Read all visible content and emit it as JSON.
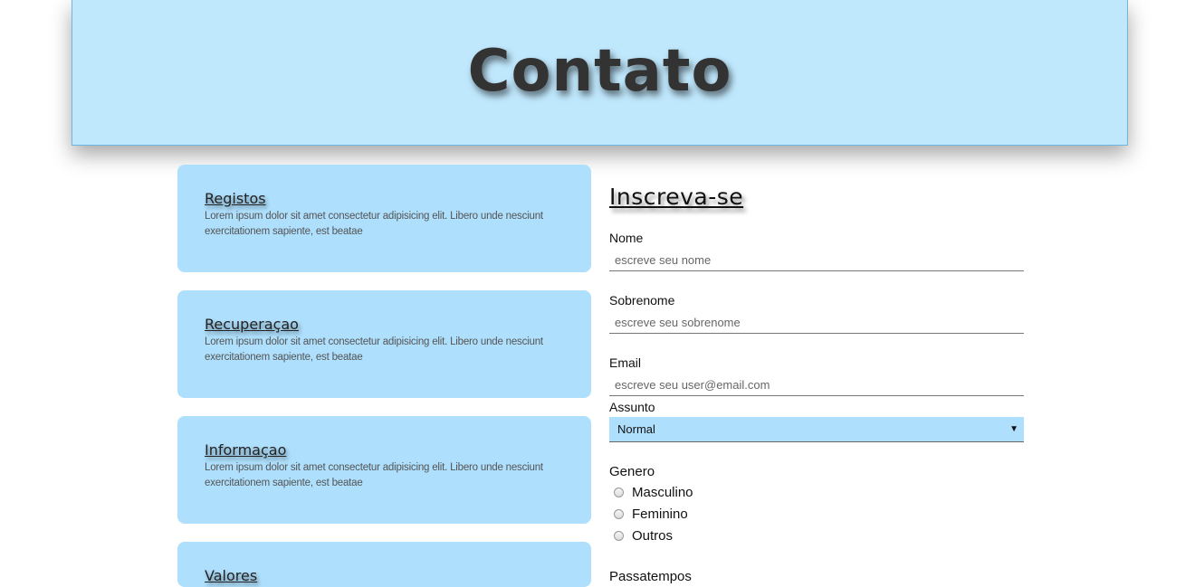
{
  "header": {
    "title": "Contato"
  },
  "cards": [
    {
      "title": "Registos",
      "text": "Lorem ipsum dolor sit amet consectetur adipisicing elit. Libero unde nesciunt exercitationem sapiente, est beatae"
    },
    {
      "title": "Recuperaçao",
      "text": "Lorem ipsum dolor sit amet consectetur adipisicing elit. Libero unde nesciunt exercitationem sapiente, est beatae"
    },
    {
      "title": "Informaçao",
      "text": "Lorem ipsum dolor sit amet consectetur adipisicing elit. Libero unde nesciunt exercitationem sapiente, est beatae"
    },
    {
      "title": "Valores",
      "text": ""
    }
  ],
  "form": {
    "title": "Inscreva-se",
    "nome": {
      "label": "Nome",
      "placeholder": "escreve seu nome"
    },
    "sobrenome": {
      "label": "Sobrenome",
      "placeholder": "escreve seu sobrenome"
    },
    "email": {
      "label": "Email",
      "placeholder": "escreve seu user@email.com"
    },
    "assunto": {
      "label": "Assunto",
      "value": "Normal",
      "arrow": "▼"
    },
    "genero": {
      "label": "Genero",
      "options": [
        "Masculino",
        "Feminino",
        "Outros"
      ]
    },
    "passatempos": {
      "label": "Passatempos"
    }
  },
  "colors": {
    "header_bg": "#c0e8fd",
    "card_bg": "#aedffc",
    "select_bg": "#aedffc"
  }
}
